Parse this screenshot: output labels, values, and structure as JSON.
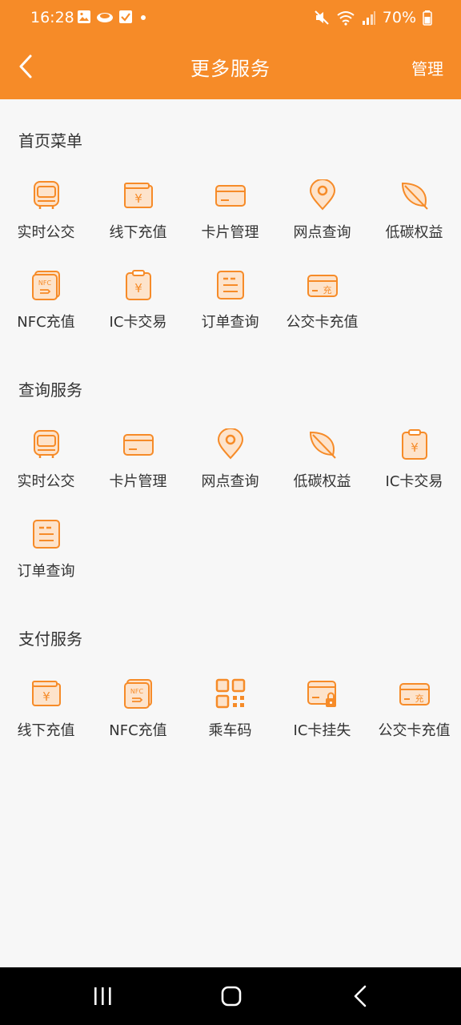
{
  "status": {
    "time": "16:28",
    "battery": "70%"
  },
  "header": {
    "title": "更多服务",
    "manage": "管理"
  },
  "sections": [
    {
      "title": "首页菜单",
      "items": [
        {
          "label": "实时公交",
          "icon": "bus-icon"
        },
        {
          "label": "线下充值",
          "icon": "yuan-wallet-icon"
        },
        {
          "label": "卡片管理",
          "icon": "card-icon"
        },
        {
          "label": "网点查询",
          "icon": "location-pin-icon"
        },
        {
          "label": "低碳权益",
          "icon": "leaf-icon"
        },
        {
          "label": "NFC充值",
          "icon": "nfc-card-icon"
        },
        {
          "label": "IC卡交易",
          "icon": "receipt-yuan-icon"
        },
        {
          "label": "订单查询",
          "icon": "order-list-icon"
        },
        {
          "label": "公交卡充值",
          "icon": "card-charge-icon"
        }
      ]
    },
    {
      "title": "查询服务",
      "items": [
        {
          "label": "实时公交",
          "icon": "bus-icon"
        },
        {
          "label": "卡片管理",
          "icon": "card-icon"
        },
        {
          "label": "网点查询",
          "icon": "location-pin-icon"
        },
        {
          "label": "低碳权益",
          "icon": "leaf-icon"
        },
        {
          "label": "IC卡交易",
          "icon": "receipt-yuan-icon"
        },
        {
          "label": "订单查询",
          "icon": "order-list-icon"
        }
      ]
    },
    {
      "title": "支付服务",
      "items": [
        {
          "label": "线下充值",
          "icon": "yuan-wallet-icon"
        },
        {
          "label": "NFC充值",
          "icon": "nfc-card-icon"
        },
        {
          "label": "乘车码",
          "icon": "qr-code-icon"
        },
        {
          "label": "IC卡挂失",
          "icon": "card-lock-icon"
        },
        {
          "label": "公交卡充值",
          "icon": "card-charge-icon"
        }
      ]
    }
  ],
  "colors": {
    "accent": "#f68b28",
    "iconFill": "#fde3cb"
  }
}
